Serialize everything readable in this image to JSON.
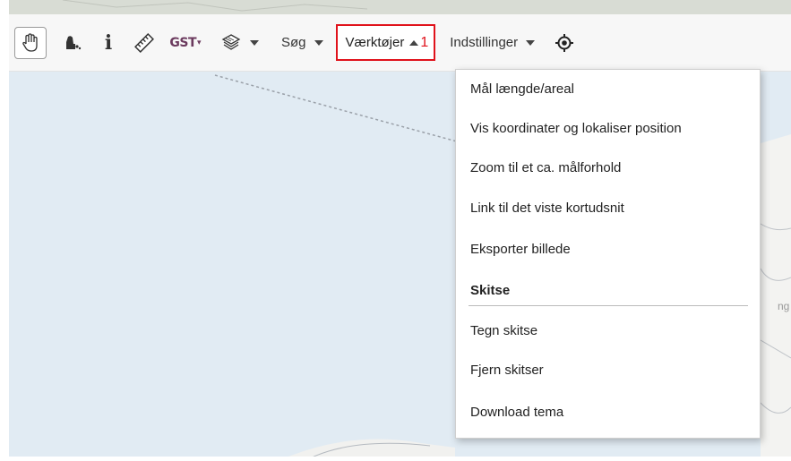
{
  "toolbar": {
    "pan_tool": "pan-hand-icon",
    "tools": [
      {
        "name": "identify-figure-icon"
      },
      {
        "name": "info-icon",
        "glyph": "i"
      },
      {
        "name": "ruler-icon"
      },
      {
        "name": "gst-logo",
        "text": "GST"
      },
      {
        "name": "layers-icon"
      }
    ],
    "search_label": "Søg",
    "tools_menu_label": "Værktøjer",
    "tools_menu_badge": "1",
    "settings_label": "Indstillinger",
    "locate_icon": "target-locate-icon"
  },
  "dropdown": {
    "items": [
      "Mål længde/areal",
      "Vis koordinater og lokaliser position",
      "Zoom til et ca. målforhold",
      "Link til det viste kortudsnit",
      "Eksporter billede"
    ],
    "section_header": "Skitse",
    "section_items": [
      "Tegn skitse",
      "Fjern skitser",
      "Download tema"
    ]
  },
  "map": {
    "partial_label": "ng"
  },
  "colors": {
    "map_water": "#e1ebf3",
    "highlight": "#e0121b",
    "toolbar_bg": "#f7f7f7"
  }
}
